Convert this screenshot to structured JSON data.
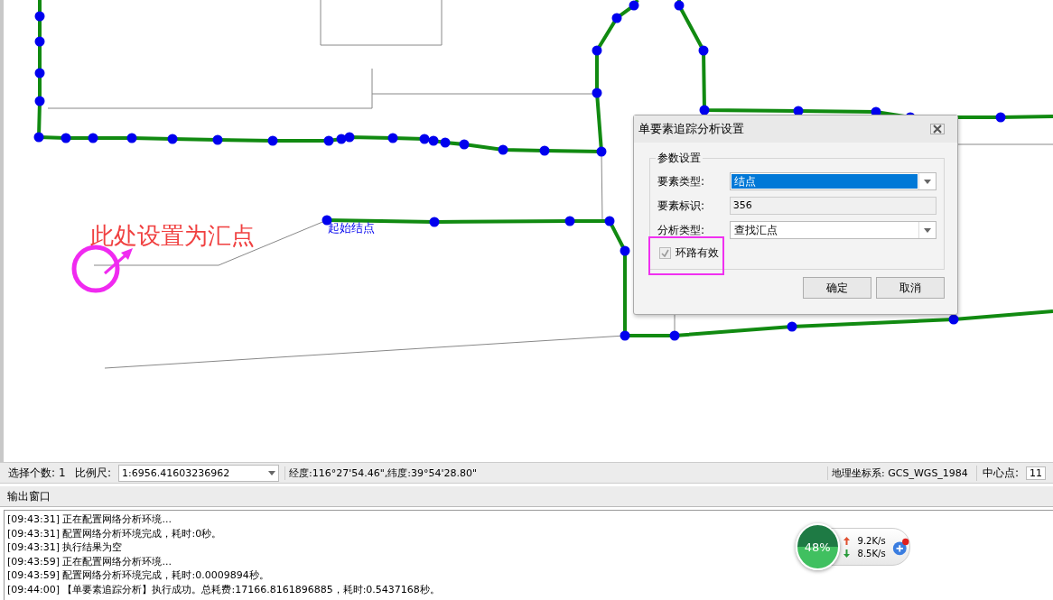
{
  "map": {
    "annotation": "此处设置为汇点",
    "start_label": "起始结点"
  },
  "dialog": {
    "title": "单要素追踪分析设置",
    "group": "参数设置",
    "fields": [
      {
        "kind": "combo",
        "label": "要素类型:",
        "value": "结点",
        "selected": true
      },
      {
        "kind": "readonly",
        "label": "要素标识:",
        "value": "356"
      },
      {
        "kind": "combo",
        "label": "分析类型:",
        "value": "查找汇点",
        "selected": false
      }
    ],
    "checkbox": {
      "label": "环路有效",
      "checked": true,
      "disabled": true
    },
    "buttons": [
      "确定",
      "取消"
    ]
  },
  "status_bar": {
    "selection_label": "选择个数:",
    "selection_count": "1",
    "scale_label": "比例尺:",
    "scale_value": "1:6956.41603236962",
    "coordinates": "经度:116°27'54.46\",纬度:39°54'28.80\"",
    "crs": "地理坐标系: GCS_WGS_1984",
    "center_label": "中心点:",
    "center_value": "11"
  },
  "output": {
    "title": "输出窗口",
    "lines": [
      "[09:43:31] 正在配置网络分析环境...",
      "[09:43:31] 配置网络分析环境完成，耗时:0秒。",
      "[09:43:31] 执行结果为空",
      "[09:43:59] 正在配置网络分析环境...",
      "[09:43:59] 配置网络分析环境完成，耗时:0.0009894秒。",
      "[09:44:00] 【单要素追踪分析】执行成功。总耗费:17166.8161896885，耗时:0.5437168秒。"
    ]
  },
  "net_widget": {
    "percent": "48%",
    "upload": "9.2K/s",
    "download": "8.5K/s"
  }
}
